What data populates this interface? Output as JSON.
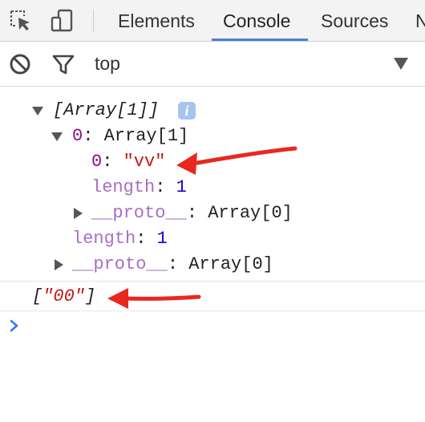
{
  "tabs": [
    {
      "label": "Elements"
    },
    {
      "label": "Console",
      "active": true
    },
    {
      "label": "Sources"
    },
    {
      "label": "N"
    }
  ],
  "filter": {
    "context": "top"
  },
  "console": {
    "array_header": "[Array[1]]",
    "info_badge": "i",
    "item0_key": "0",
    "item0_colon": ":",
    "item0_value": "Array[1]",
    "inner0_key": "0",
    "inner0_colon": ":",
    "inner0_value": "\"vv\"",
    "inner_length_key": "length",
    "inner_length_colon": ":",
    "inner_length_value": "1",
    "inner_proto_key": "__proto__",
    "inner_proto_colon": ":",
    "inner_proto_value": "Array[0]",
    "outer_length_key": "length",
    "outer_length_colon": ":",
    "outer_length_value": "1",
    "outer_proto_key": "__proto__",
    "outer_proto_colon": ":",
    "outer_proto_value": "Array[0]",
    "result_open": "[",
    "result_value": "\"00\"",
    "result_close": "]"
  },
  "colors": {
    "accent": "#4d7fd9",
    "string": "#c41a16",
    "number": "#1c00cf",
    "key": "#881280",
    "annotation_arrow": "#e8281f"
  },
  "icons": [
    "inspect-element-icon",
    "device-toolbar-icon",
    "clear-console-icon",
    "filter-icon",
    "dropdown-triangle-icon",
    "console-prompt-icon"
  ]
}
